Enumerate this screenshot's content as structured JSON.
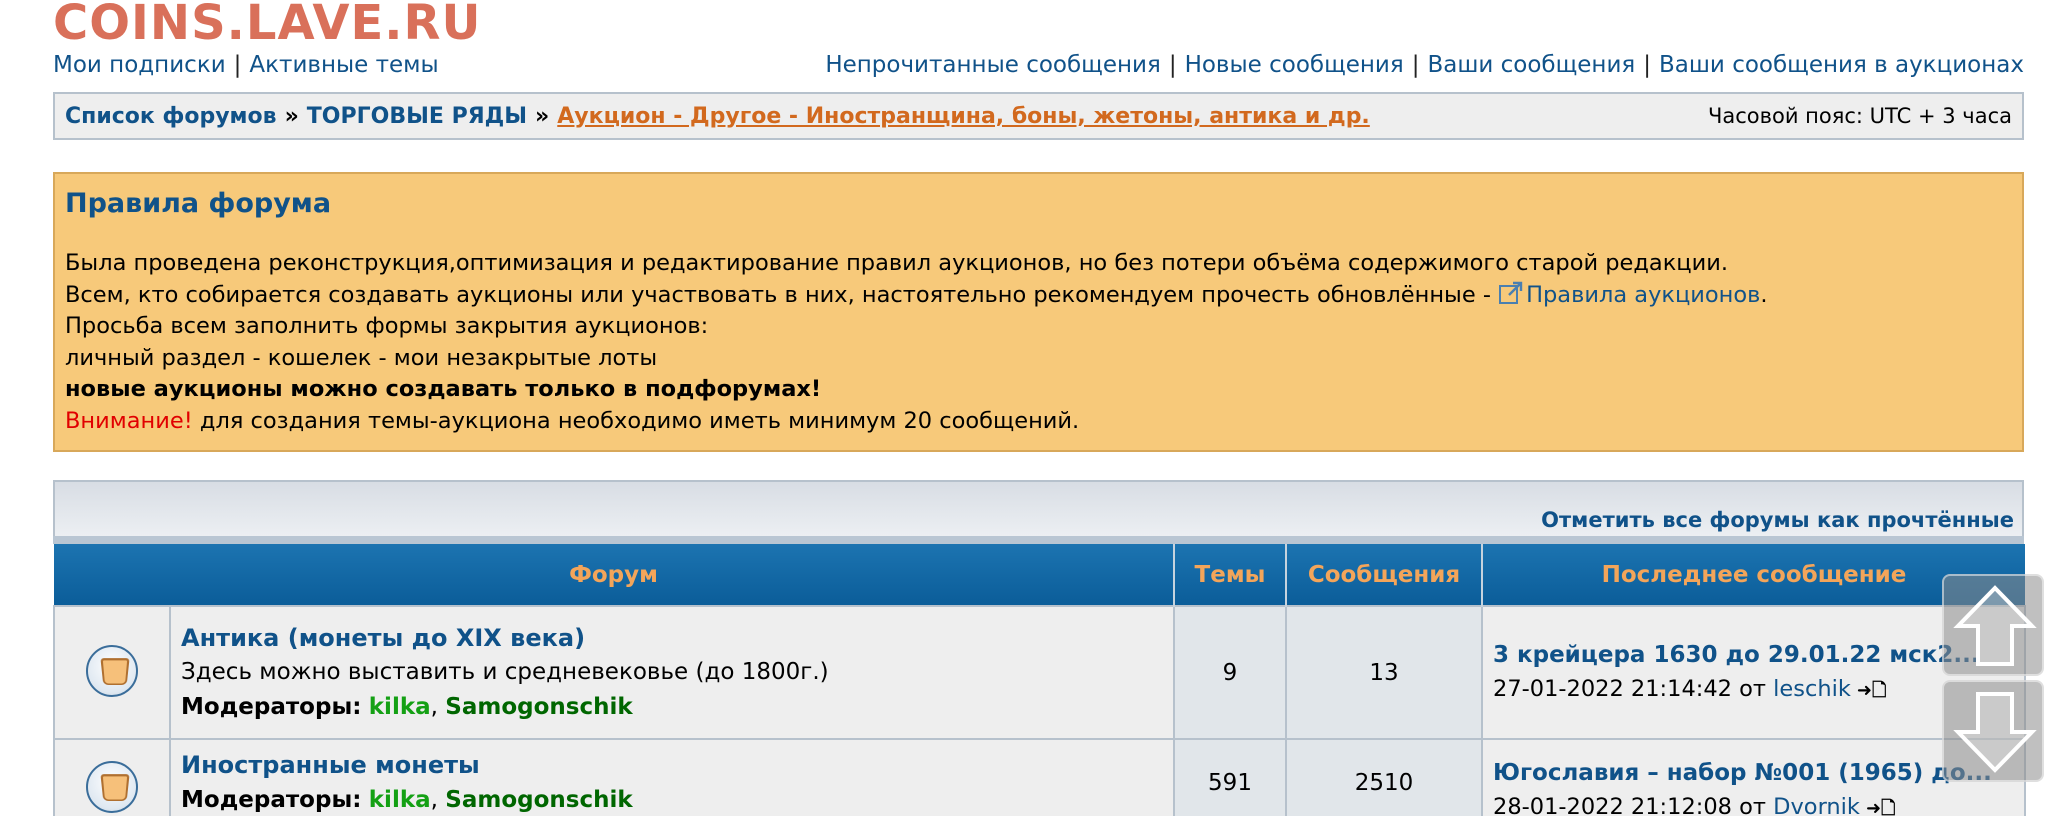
{
  "site": {
    "logo": "COINS.LAVE.RU"
  },
  "toplinks": {
    "left": [
      "Мои подписки",
      "Активные темы"
    ],
    "right": [
      "Непрочитанные сообщения",
      "Новые сообщения",
      "Ваши сообщения",
      "Ваши сообщения в аукционах"
    ]
  },
  "breadcrumb": {
    "items": [
      "Список форумов",
      "ТОРГОВЫЕ РЯДЫ"
    ],
    "separator": "»",
    "current": "Аукцион - Другое - Иностранщина, боны, жетоны, антика и др.",
    "timezone": "Часовой пояс: UTC + 3 часа"
  },
  "rules": {
    "title": "Правила форума",
    "line1": "Была проведена реконструкция,оптимизация и редактирование правил аукционов, но без потери объёма содержимого старой редакции.",
    "line2_prefix": "Всем, кто собирается создавать аукционы или участвовать в них, настоятельно рекомендуем прочесть обновлённые - ",
    "line2_link": "Правила аукционов",
    "line2_suffix": ".",
    "line3": "Просьба всем заполнить формы закрытия аукционов:",
    "line4": "личный раздел - кошелек - мои незакрытые лоты",
    "line5": "новые аукционы можно создавать только в подфорумах!",
    "line6_warn": "Внимание!",
    "line6_rest": " для создания темы-аукциона необходимо иметь минимум 20 сообщений."
  },
  "mark_all_read": "Отметить все форумы как прочтённые",
  "table": {
    "headers": {
      "forum": "Форум",
      "topics": "Темы",
      "posts": "Сообщения",
      "last": "Последнее сообщение"
    },
    "rows": [
      {
        "name": "Антика (монеты до XIX века)",
        "desc": "Здесь можно выставить и средневековье (до 1800г.)",
        "mods_label": "Модераторы:",
        "mod1": "kilka",
        "mod2": "Samogonschik",
        "topics": "9",
        "posts": "13",
        "last_title": "3 крейцера 1630 до 29.01.22 мск2...",
        "last_date": "27-01-2022 21:14:42",
        "last_by": "от",
        "last_user": "leschik"
      },
      {
        "name": "Иностранные монеты",
        "desc": "",
        "mods_label": "Модераторы:",
        "mod1": "kilka",
        "mod2": "Samogonschik",
        "topics": "591",
        "posts": "2510",
        "last_title": "Югославия – набор №001 (1965) до...",
        "last_date": "28-01-2022 21:12:08",
        "last_by": "от",
        "last_user": "Dvornik"
      }
    ]
  },
  "icons": {
    "forum": "forum-read-icon",
    "external": "external-link-icon",
    "goto": "go-to-last-post-icon",
    "up": "scroll-up-icon",
    "down": "scroll-down-icon"
  }
}
